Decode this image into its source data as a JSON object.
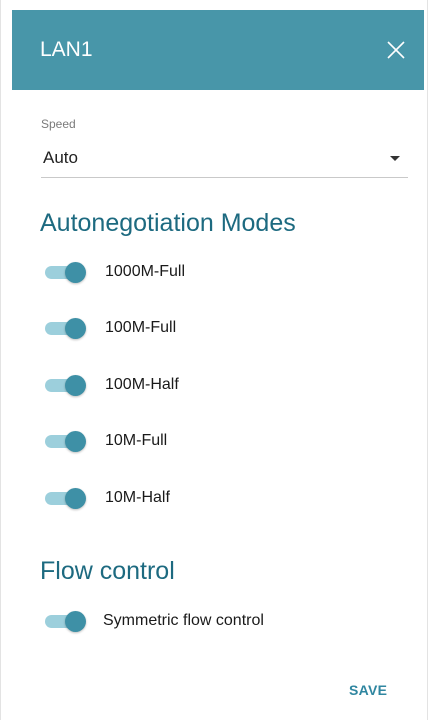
{
  "header": {
    "title": "LAN1",
    "close_icon": "close-icon",
    "color": "#4896a9"
  },
  "speed": {
    "label": "Speed",
    "value": "Auto"
  },
  "autonegotiation": {
    "title": "Autonegotiation Modes",
    "modes": [
      {
        "label": "1000M-Full",
        "enabled": true
      },
      {
        "label": "100M-Full",
        "enabled": true
      },
      {
        "label": "100M-Half",
        "enabled": true
      },
      {
        "label": "10M-Full",
        "enabled": true
      },
      {
        "label": "10M-Half",
        "enabled": true
      }
    ]
  },
  "flow_control": {
    "title": "Flow control",
    "options": [
      {
        "label": "Symmetric flow control",
        "enabled": true
      }
    ]
  },
  "footer": {
    "save_label": "SAVE"
  },
  "colors": {
    "accent": "#3e90a6",
    "track": "#9ccfdc",
    "section_title": "#1d6a80",
    "save": "#2f86a0"
  }
}
